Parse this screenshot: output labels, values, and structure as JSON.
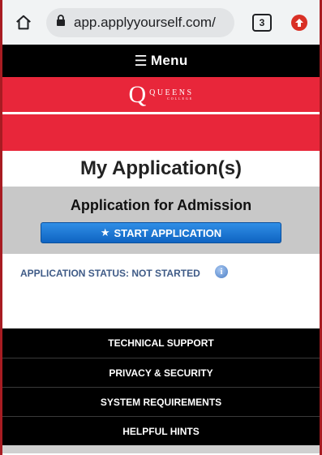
{
  "browser": {
    "url": "app.applyyourself.com/",
    "tab_count": "3"
  },
  "menu": {
    "label": "Menu"
  },
  "logo": {
    "letter": "Q",
    "name": "QUEENS",
    "sub": "COLLEGE"
  },
  "page": {
    "title": "My Application(s)"
  },
  "admission": {
    "heading": "Application for Admission",
    "start_label": "START APPLICATION",
    "status": "APPLICATION STATUS: NOT STARTED"
  },
  "footer": {
    "links": [
      {
        "label": "TECHNICAL SUPPORT"
      },
      {
        "label": "PRIVACY & SECURITY"
      },
      {
        "label": "SYSTEM REQUIREMENTS"
      },
      {
        "label": "HELPFUL HINTS"
      }
    ]
  },
  "colors": {
    "brand_red": "#e8263a",
    "button_blue": "#1a75d2",
    "status_text": "#3f5b87"
  },
  "icons": [
    "home-icon",
    "lock-icon",
    "tabs-icon",
    "profile-upload-icon",
    "hamburger-icon",
    "star-icon",
    "info-icon"
  ]
}
